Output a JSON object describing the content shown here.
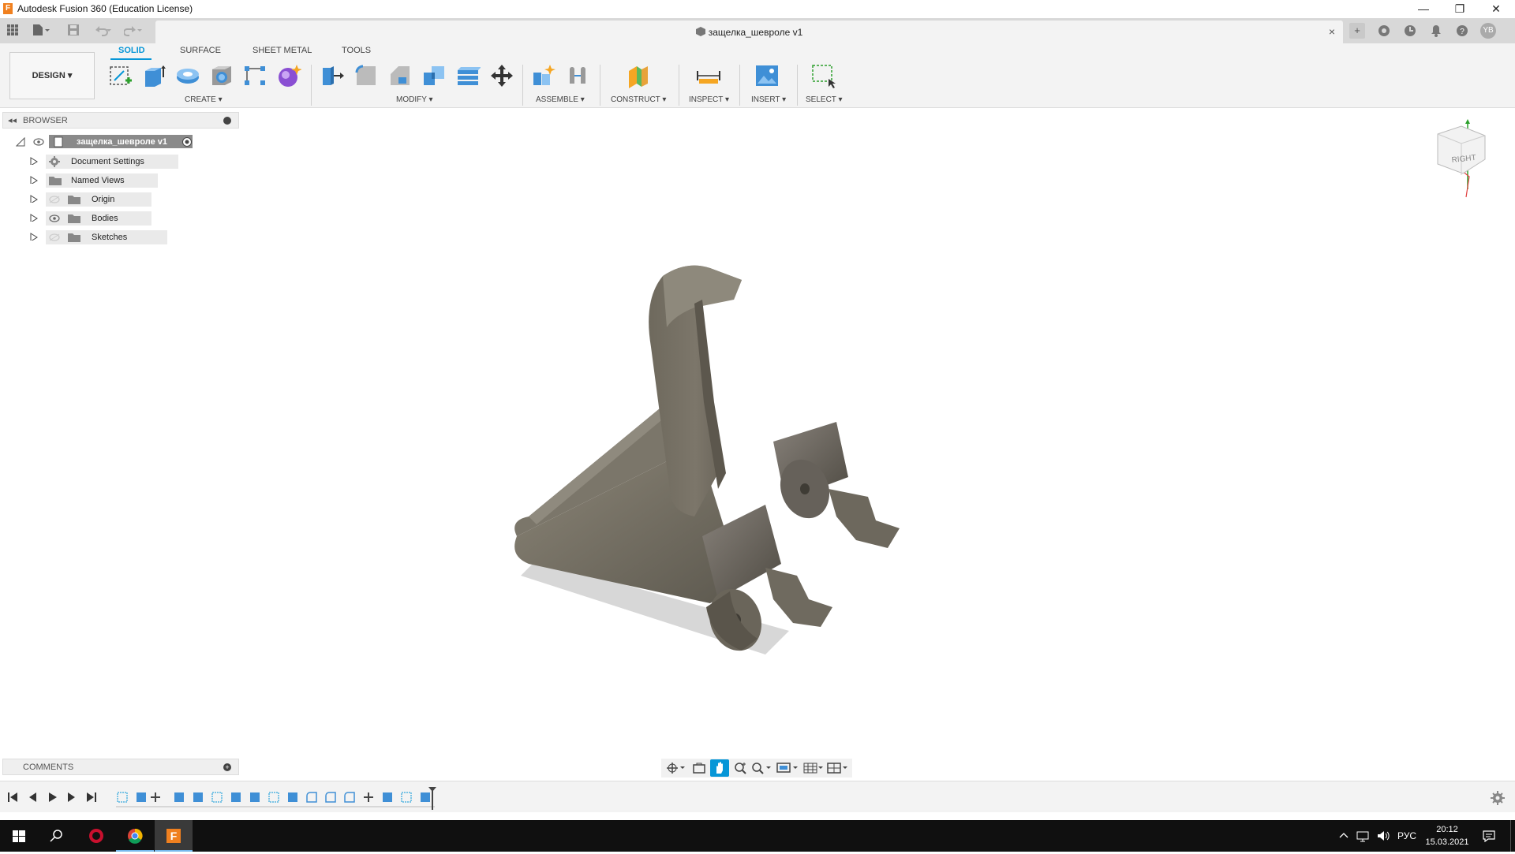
{
  "window": {
    "title": "Autodesk Fusion 360 (Education License)",
    "minimize": "—",
    "restore": "❐",
    "close": "✕"
  },
  "tabbar": {
    "document_title": "защелка_шевроле v1",
    "close": "×",
    "user_initials": "YB"
  },
  "toolbar": {
    "design_label": "DESIGN",
    "workspace_tabs": [
      "SOLID",
      "SURFACE",
      "SHEET METAL",
      "TOOLS"
    ],
    "active_tab": "SOLID",
    "groups": {
      "create": "CREATE",
      "modify": "MODIFY",
      "assemble": "ASSEMBLE",
      "construct": "CONSTRUCT",
      "inspect": "INSPECT",
      "insert": "INSERT",
      "select": "SELECT"
    }
  },
  "browser": {
    "header": "BROWSER",
    "root": "защелка_шевроле v1",
    "items": [
      {
        "label": "Document Settings",
        "icon": "gear-icon"
      },
      {
        "label": "Named Views",
        "icon": "folder-icon"
      },
      {
        "label": "Origin",
        "icon": "folder-icon"
      },
      {
        "label": "Bodies",
        "icon": "folder-icon"
      },
      {
        "label": "Sketches",
        "icon": "folder-icon"
      }
    ]
  },
  "viewcube": {
    "face": "RIGHT"
  },
  "comments": {
    "header": "COMMENTS"
  },
  "taskbar": {
    "language": "РУС",
    "time": "20:12",
    "date": "15.03.2021"
  },
  "colors": {
    "accent": "#0696d7",
    "model": "#7a7466",
    "brand": "#f0801f"
  }
}
